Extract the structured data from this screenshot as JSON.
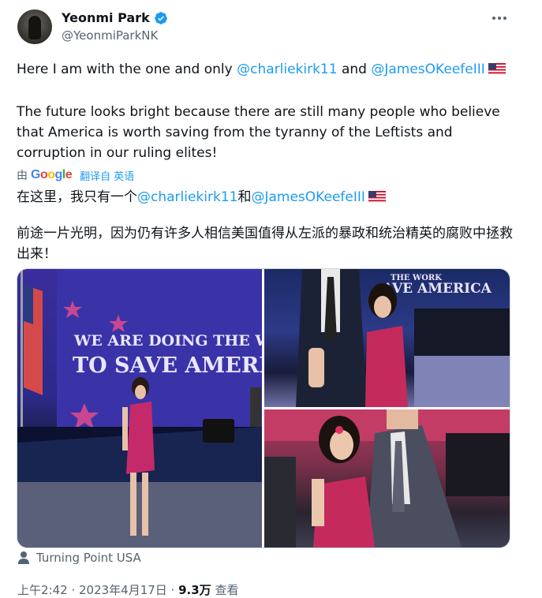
{
  "author": {
    "display_name": "Yeonmi Park",
    "handle": "@YeonmiParkNK"
  },
  "tweet": {
    "line1_prefix": "Here I am with the one and only ",
    "mention1": "@charliekirk11",
    "line1_mid": " and ",
    "mention2": "@JamesOKeefeIII",
    "paragraph2": "The future looks bright because there are still many people who believe that America is worth saving from the tyranny of the Leftists and corruption in our ruling elites!"
  },
  "translation": {
    "by_label": "由",
    "google_letters": [
      "G",
      "o",
      "o",
      "g",
      "l",
      "e"
    ],
    "translated_from_label": "翻译自 英语",
    "zh_line1_prefix": "在这里，我只有一个",
    "zh_mention1": "@charliekirk11",
    "zh_and": "和",
    "zh_mention2": "@JamesOKeefeIII",
    "zh_paragraph2": "前途一片光明，因为仍有许多人相信美国值得从左派的暴政和统治精英的腐败中拯救出来！"
  },
  "media": {
    "photo1_banner_line1": "WE ARE DOING THE WORK",
    "photo1_banner_line2": "TO SAVE AMERICA",
    "photo2_banner_line1": "THE WORK",
    "photo2_banner_line2": "AVE AMERICA"
  },
  "location": {
    "label": "Turning Point USA"
  },
  "meta": {
    "time": "上午2:42 · 2023年4月17日 · ",
    "views_count": "9.3万",
    "views_label": " 查看"
  },
  "colors": {
    "link": "#1d9bf0",
    "secondary_text": "#536471",
    "verified": "#1d9bf0",
    "google": [
      "#4285F4",
      "#EA4335",
      "#FBBC05",
      "#4285F4",
      "#34A853",
      "#EA4335"
    ]
  },
  "icons": {
    "verified": "verified-badge-icon",
    "more": "more-dots-icon",
    "location": "person-pin-icon",
    "flag": "us-flag-icon"
  }
}
